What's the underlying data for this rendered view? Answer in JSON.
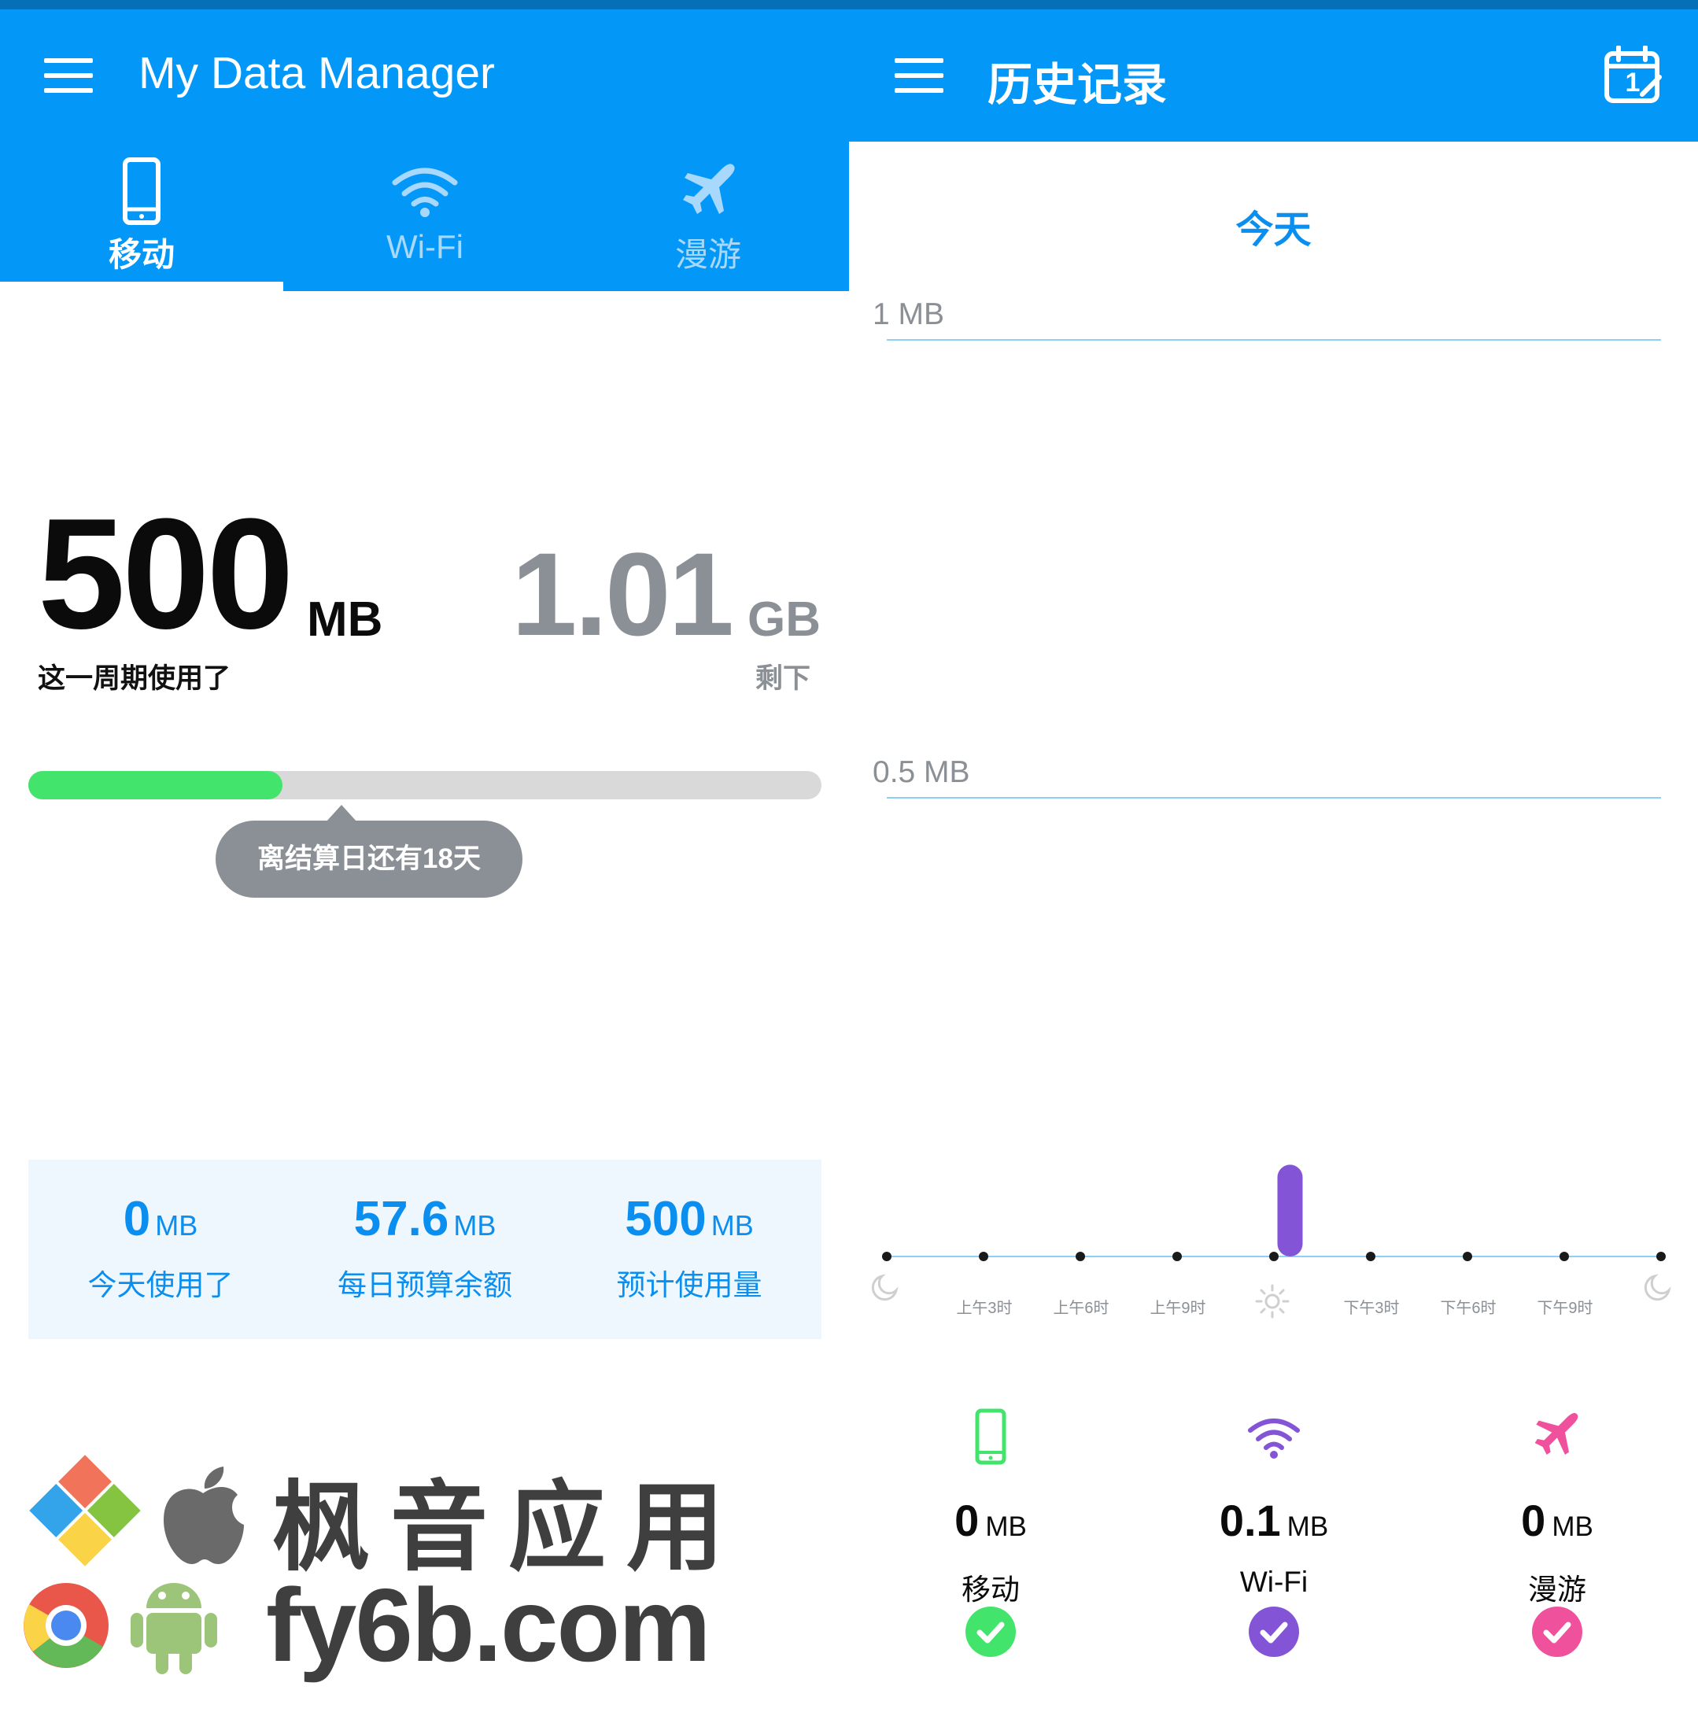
{
  "left": {
    "app_title": "My Data Manager",
    "tabs": [
      {
        "label": "移动",
        "icon": "phone-icon",
        "active": true
      },
      {
        "label": "Wi-Fi",
        "icon": "wifi-icon",
        "active": false
      },
      {
        "label": "漫游",
        "icon": "airplane-icon",
        "active": false
      }
    ],
    "usage": {
      "value": "500",
      "unit": "MB",
      "label": "这一周期使用了"
    },
    "remaining": {
      "value": "1.01",
      "unit": "GB",
      "label": "剩下"
    },
    "progress": {
      "fraction": 0.32,
      "color": "#43e46b"
    },
    "cycle_tooltip": "离结算日还有18天",
    "stats": [
      {
        "value": "0",
        "unit": "MB",
        "label": "今天使用了"
      },
      {
        "value": "57.6",
        "unit": "MB",
        "label": "每日预算余额"
      },
      {
        "value": "500",
        "unit": "MB",
        "label": "预计使用量"
      }
    ],
    "watermark": {
      "line1": "枫音应用",
      "line2": "fy6b.com"
    }
  },
  "right": {
    "title": "历史记录",
    "calendar_day": "1",
    "day": "今天",
    "y_labels": [
      "1 MB",
      "0.5 MB"
    ],
    "time_labels": [
      "上午3时",
      "上午6时",
      "上午9时",
      "下午3时",
      "下午6时",
      "下午9时"
    ],
    "chart_data": {
      "type": "bar",
      "categories": [
        "0",
        "1",
        "2",
        "3",
        "4",
        "5",
        "6",
        "7",
        "8",
        "9",
        "10",
        "11",
        "12",
        "13",
        "14",
        "15",
        "16",
        "17",
        "18",
        "19",
        "20",
        "21",
        "22",
        "23"
      ],
      "ylim": [
        0,
        1
      ],
      "ylabel": "MB",
      "series": [
        {
          "name": "Wi-Fi",
          "color": "#8355d6",
          "values": [
            0,
            0,
            0,
            0,
            0,
            0,
            0,
            0,
            0,
            0,
            0,
            0,
            0.1,
            0,
            0,
            0,
            0,
            0,
            0,
            0,
            0,
            0,
            0,
            0
          ]
        }
      ]
    },
    "legend": [
      {
        "value": "0",
        "unit": "MB",
        "name": "移动",
        "color": "#43e46b",
        "icon": "phone-icon"
      },
      {
        "value": "0.1",
        "unit": "MB",
        "name": "Wi-Fi",
        "color": "#8355d6",
        "icon": "wifi-icon"
      },
      {
        "value": "0",
        "unit": "MB",
        "name": "漫游",
        "color": "#f0519c",
        "icon": "airplane-icon"
      }
    ],
    "colors": {
      "appbar": "#0398f8",
      "accent": "#0a8ff0",
      "gridline": "#8ecff8"
    }
  }
}
